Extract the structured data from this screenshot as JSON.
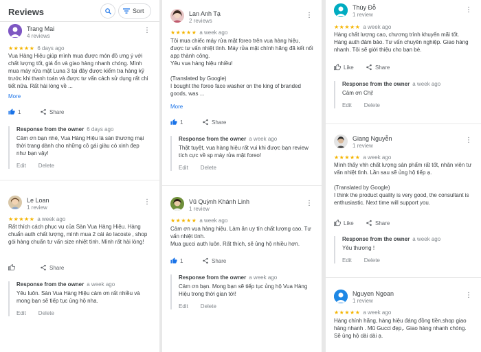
{
  "header": {
    "title": "Reviews",
    "sort_label": "Sort"
  },
  "colors": {
    "star": "#f4b400",
    "link": "#1a73e8",
    "like_active": "#1a73e8"
  },
  "labels": {
    "more": "More",
    "like": "Like",
    "share": "Share",
    "response": "Response from the owner",
    "edit": "Edit",
    "delete": "Delete",
    "stars": "★★★★★"
  },
  "reviews": [
    {
      "name": "Trang Mai",
      "count": "4 reviews",
      "date": "6 days ago",
      "text": "Vua Hàng Hiệu giúp mình mua được món đồ ưng ý với chất lượng tốt, giá ổn và giao hàng nhanh chóng. Mình mua máy rửa mặt Luna 3 tại đây được kiểm tra hàng kỹ trước khi thanh toán và được tư vấn cách sử dụng rất chi tiết nữa. Rất hài lòng về ...",
      "likes": "1",
      "owner_date": "6 days ago",
      "owner_text": "Cảm ơn bạn nhé, Vua Hàng Hiệu là sàn thương mại thời trang dành cho những cô gái giàu có xinh đẹp như bạn vậy!"
    },
    {
      "name": "Le Loan",
      "count": "1 review",
      "date": "a week ago",
      "text": "Rất thích cách phục vụ của Sàn Vua Hàng Hiệu. Hàng chuẩn auth chất lượng, mình mua 2 cái áo lacoste , shop gói hàng chuẩn tư vấn size nhiệt tình. Mình rất hài lòng!",
      "owner_date": "a week ago",
      "owner_text": "Yêu luôn. Sàn Vua Hàng Hiệu cảm ơn rất nhiều và mong bạn sẽ tiếp tục ủng hộ nha."
    },
    {
      "name": "Lan Anh Tạ",
      "count": "2 reviews",
      "date": "a week ago",
      "text": "Tôi mua chiếc máy rửa mặt foreo trên vua hàng hiệu, được tư vấn nhiệt tình. Máy rửa mặt chính hãng đã kết nối app thành công.\nYêu vua hàng hiệu nhiều!\n\n(Translated by Google)\nI bought the foreo face washer on the king of branded goods, was ...",
      "likes": "1",
      "owner_date": "a week ago",
      "owner_text": "Thật tuyệt, vua hàng hiệu rất vui khi được bạn review tích cực về sp máy rửa mặt foreo!"
    },
    {
      "name": "Vũ Quỳnh Khánh Linh",
      "count": "1 review",
      "date": "a week ago",
      "text": "Cảm ơn vua hàng hiệu. Làm ăn uy tín chất lượng cao. Tư vấn nhiệt tình.\nMua gucci auth luôn. Rất thích, sẽ ủng hộ nhiều hơn.",
      "likes": "1",
      "owner_date": "a week ago",
      "owner_text": "Cảm ơn bạn. Mong bạn sẽ tiếp tục ủng hộ Vua Hàng Hiệu trong thời gian tới!"
    },
    {
      "name": "Thùy Đỗ",
      "count": "1 review",
      "date": "a week ago",
      "text": "Hàng chất lượng cao, chương trình khuyến mãi tốt. Hàng auth đảm bảo. Tư vấn chuyên nghiệp. Giao hàng nhanh. Tôi sẽ giới thiệu cho bạn bè.",
      "owner_date": "a week ago",
      "owner_text": "Cảm ơn Chị!"
    },
    {
      "name": "Giang Nguyễn",
      "count": "1 review",
      "date": "a week ago",
      "text": "Mình thấy vhh  chất lượng sản phẩm rất tốt, nhân viên tư vấn nhiệt tình. Lần sau sẽ ủng hộ tiếp ạ.\n\n(Translated by Google)\nI think the product quality is very good, the consultant is enthusiastic. Next time will support you.",
      "owner_date": "a week ago",
      "owner_text": "Yêu thương !"
    },
    {
      "name": "Nguyen Ngoan",
      "count": "1 review",
      "date": "a week ago",
      "text": "Hàng chính hãng, hàng hiệu đáng đồng tiền.shop giao hàng nhanh . Mũ Gucci đẹp,. Giao hàng nhanh chóng. Sẽ ủng hộ dài dài ạ."
    }
  ]
}
